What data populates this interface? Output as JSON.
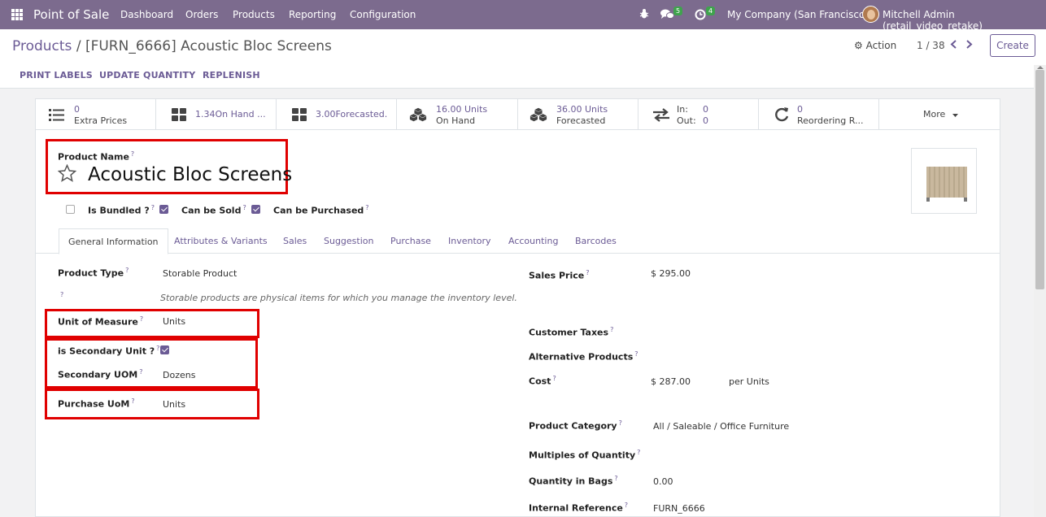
{
  "navbar": {
    "app_name": "Point of Sale",
    "menu": [
      "Dashboard",
      "Orders",
      "Products",
      "Reporting",
      "Configuration"
    ],
    "messages_count": "5",
    "activities_count": "4",
    "company": "My Company (San Francisco)",
    "user": "Mitchell Admin (retail_video_retake)"
  },
  "breadcrumb": {
    "parent": "Products",
    "separator": "/",
    "current": "[FURN_6666] Acoustic Bloc Screens"
  },
  "control": {
    "action_label": "Action",
    "pager": "1 / 38",
    "create_label": "Create"
  },
  "actions": [
    "PRINT LABELS",
    "UPDATE QUANTITY",
    "REPLENISH"
  ],
  "smart_buttons": {
    "extra_prices": {
      "value": "0",
      "label": "Extra Prices"
    },
    "on_hand_variant": {
      "label": "1.34On Hand ..."
    },
    "forecasted_variant": {
      "label": "3.00Forecasted."
    },
    "on_hand": {
      "value": "16.00 Units",
      "label": "On Hand"
    },
    "forecasted": {
      "value": "36.00 Units",
      "label": "Forecasted"
    },
    "in_out": {
      "in_label": "In:",
      "in_value": "0",
      "out_label": "Out:",
      "out_value": "0"
    },
    "reordering": {
      "value": "0",
      "label": "Reordering R..."
    },
    "more": "More"
  },
  "product": {
    "name_label": "Product Name",
    "name": "Acoustic Bloc Screens",
    "is_bundled_label": "Is Bundled ?",
    "can_be_sold_label": "Can be Sold",
    "can_be_purchased_label": "Can be Purchased",
    "is_bundled": false,
    "can_be_sold": true,
    "can_be_purchased": true
  },
  "tabs": [
    "General Information",
    "Attributes & Variants",
    "Sales",
    "Suggestion",
    "Purchase",
    "Inventory",
    "Accounting",
    "Barcodes"
  ],
  "general": {
    "product_type_label": "Product Type",
    "product_type": "Storable Product",
    "product_type_help": "Storable products are physical items for which you manage the inventory level.",
    "uom_label": "Unit of Measure",
    "uom": "Units",
    "is_secondary_label": "is Secondary Unit ?",
    "is_secondary": true,
    "secondary_uom_label": "Secondary UOM",
    "secondary_uom": "Dozens",
    "purchase_uom_label": "Purchase UoM",
    "purchase_uom": "Units",
    "sales_price_label": "Sales Price",
    "sales_price": "$ 295.00",
    "customer_taxes_label": "Customer Taxes",
    "alt_products_label": "Alternative Products",
    "cost_label": "Cost",
    "cost": "$ 287.00",
    "cost_unit": "per Units",
    "category_label": "Product Category",
    "category": "All / Saleable / Office Furniture",
    "multiples_label": "Multiples of Quantity",
    "qty_bags_label": "Quantity in Bags",
    "qty_bags": "0.00",
    "internal_ref_label": "Internal Reference",
    "internal_ref": "FURN_6666"
  },
  "help_mark": "?",
  "colors": {
    "navbar": "#7c6b8e",
    "accent": "#6b5b95",
    "highlight": "#e00000"
  }
}
